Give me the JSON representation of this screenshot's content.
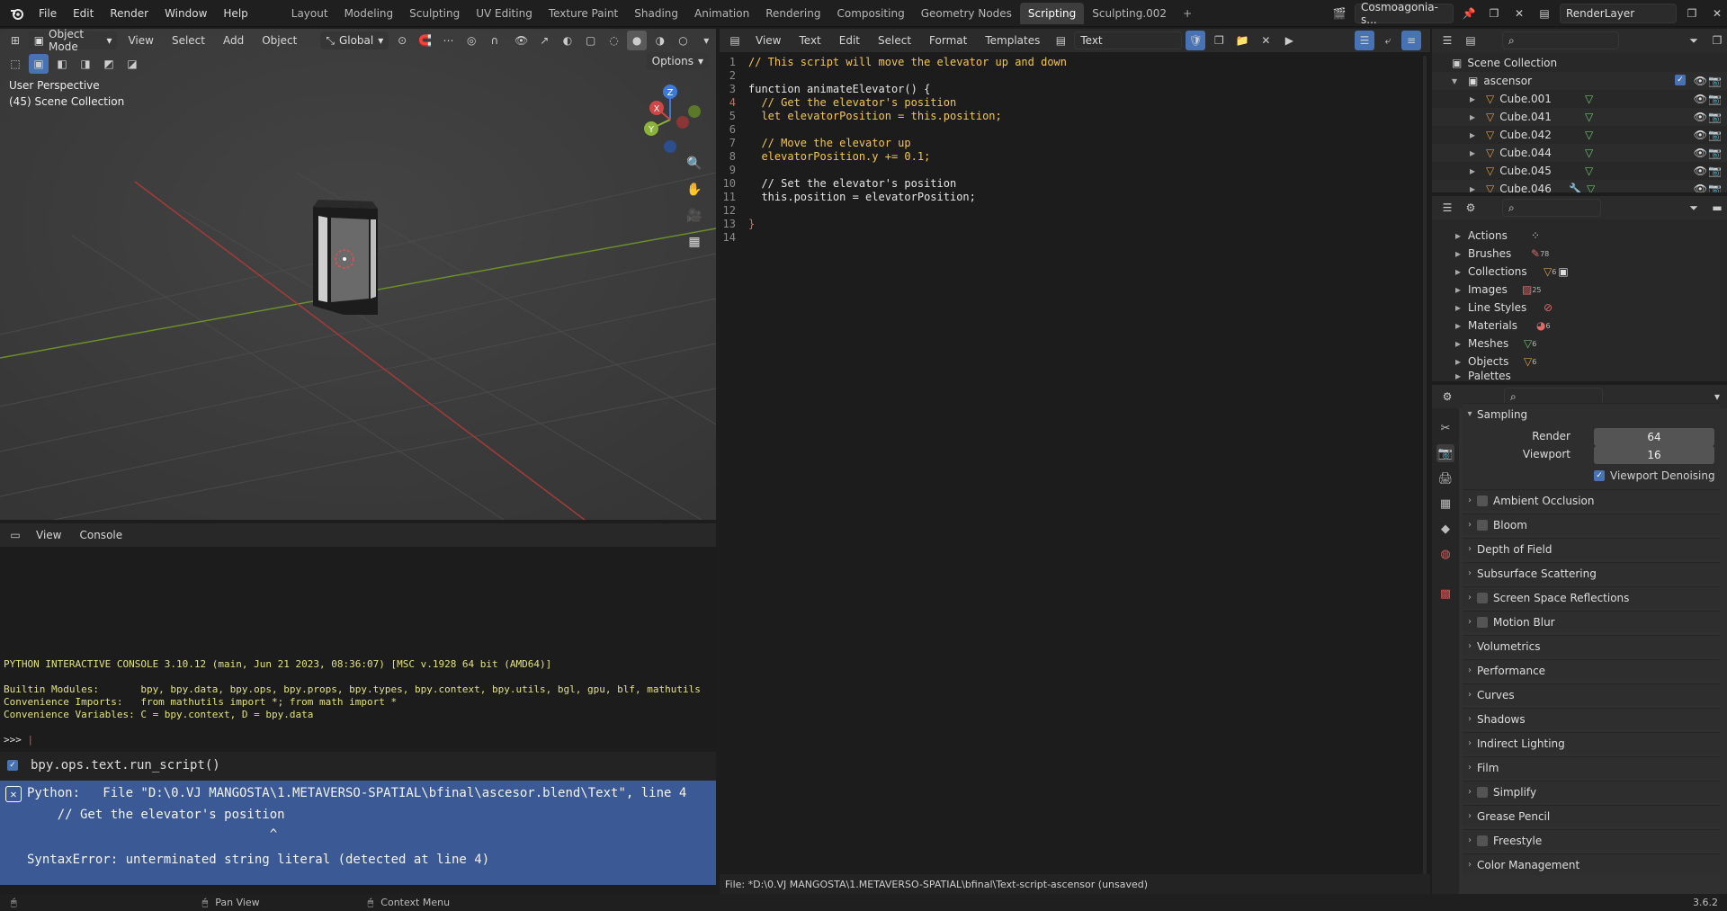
{
  "topbar": {
    "menus": [
      "File",
      "Edit",
      "Render",
      "Window",
      "Help"
    ],
    "workspaces": [
      "Layout",
      "Modeling",
      "Sculpting",
      "UV Editing",
      "Texture Paint",
      "Shading",
      "Animation",
      "Rendering",
      "Compositing",
      "Geometry Nodes",
      "Scripting",
      "Sculpting.002"
    ],
    "active_workspace": "Scripting",
    "scene_name": "Cosmoagonia-s...",
    "view_layer": "RenderLayer"
  },
  "viewport": {
    "mode": "Object Mode",
    "menus": [
      "View",
      "Select",
      "Add",
      "Object"
    ],
    "transform_orientation": "Global",
    "options_label": "Options",
    "info_line1": "User Perspective",
    "info_line2": "(45) Scene Collection",
    "gizmo": {
      "x": "X",
      "y": "Y",
      "z": "Z"
    }
  },
  "console": {
    "menus": [
      "View",
      "Console"
    ],
    "banner": "PYTHON INTERACTIVE CONSOLE 3.10.12 (main, Jun 21 2023, 08:36:07) [MSC v.1928 64 bit (AMD64)]",
    "builtin": "Builtin Modules:       bpy, bpy.data, bpy.ops, bpy.props, bpy.types, bpy.context, bpy.utils, bgl, gpu, blf, mathutils",
    "imports": "Convenience Imports:   from mathutils import *; from math import *",
    "variables": "Convenience Variables: C = bpy.context, D = bpy.data",
    "prompt": ">>> "
  },
  "infolog": {
    "run": "bpy.ops.text.run_script()",
    "err1": "Python:   File \"D:\\0.VJ MANGOSTA\\1.METAVERSO-SPATIAL\\bfinal\\ascesor.blend\\Text\", line 4",
    "err2": "    // Get the elevator's position",
    "err3": "                                ^",
    "err4": "SyntaxError: unterminated string literal (detected at line 4)"
  },
  "texteditor": {
    "menus": [
      "View",
      "Text",
      "Edit",
      "Select",
      "Format",
      "Templates"
    ],
    "text_name": "Text",
    "current_line": 4,
    "lines": [
      "// This script will move the elevator up and down",
      "",
      "function animateElevator() {",
      "  // Get the elevator's position",
      "  let elevatorPosition = this.position;",
      "",
      "  // Move the elevator up",
      "  elevatorPosition.y += 0.1;",
      "",
      "  // Set the elevator's position",
      "  this.position = elevatorPosition;",
      "",
      "}",
      ""
    ],
    "footer": "File: *D:\\0.VJ MANGOSTA\\1.METAVERSO-SPATIAL\\bfinal\\Text-script-ascensor (unsaved)"
  },
  "outliner": {
    "root": "Scene Collection",
    "collection": "ascensor",
    "objects": [
      "Cube.001",
      "Cube.041",
      "Cube.042",
      "Cube.044",
      "Cube.045",
      "Cube.046"
    ]
  },
  "blendfile": {
    "items": [
      {
        "name": "Actions",
        "count": ""
      },
      {
        "name": "Brushes",
        "count": "78"
      },
      {
        "name": "Collections",
        "count": "6"
      },
      {
        "name": "Images",
        "count": "25"
      },
      {
        "name": "Line Styles",
        "count": ""
      },
      {
        "name": "Materials",
        "count": "6"
      },
      {
        "name": "Meshes",
        "count": "6"
      },
      {
        "name": "Objects",
        "count": "6"
      },
      {
        "name": "Palettes",
        "count": ""
      }
    ]
  },
  "properties": {
    "sampling": {
      "title": "Sampling",
      "render_label": "Render",
      "render_value": "64",
      "viewport_label": "Viewport",
      "viewport_value": "16",
      "denoise_label": "Viewport Denoising"
    },
    "sections": [
      {
        "label": "Ambient Occlusion",
        "checkbox": true
      },
      {
        "label": "Bloom",
        "checkbox": true
      },
      {
        "label": "Depth of Field",
        "checkbox": false
      },
      {
        "label": "Subsurface Scattering",
        "checkbox": false
      },
      {
        "label": "Screen Space Reflections",
        "checkbox": true
      },
      {
        "label": "Motion Blur",
        "checkbox": true
      },
      {
        "label": "Volumetrics",
        "checkbox": false
      },
      {
        "label": "Performance",
        "checkbox": false
      },
      {
        "label": "Curves",
        "checkbox": false
      },
      {
        "label": "Shadows",
        "checkbox": false
      },
      {
        "label": "Indirect Lighting",
        "checkbox": false
      },
      {
        "label": "Film",
        "checkbox": false
      },
      {
        "label": "Simplify",
        "checkbox": true
      },
      {
        "label": "Grease Pencil",
        "checkbox": false
      },
      {
        "label": "Freestyle",
        "checkbox": true
      },
      {
        "label": "Color Management",
        "checkbox": false
      }
    ]
  },
  "statusbar": {
    "pan": "Pan View",
    "context": "Context Menu",
    "version": "3.6.2"
  },
  "colors": {
    "accent": "#4772b3",
    "error_bg": "#3b5a95",
    "comment": "#f5c64a",
    "console_text": "#e2e27a"
  }
}
